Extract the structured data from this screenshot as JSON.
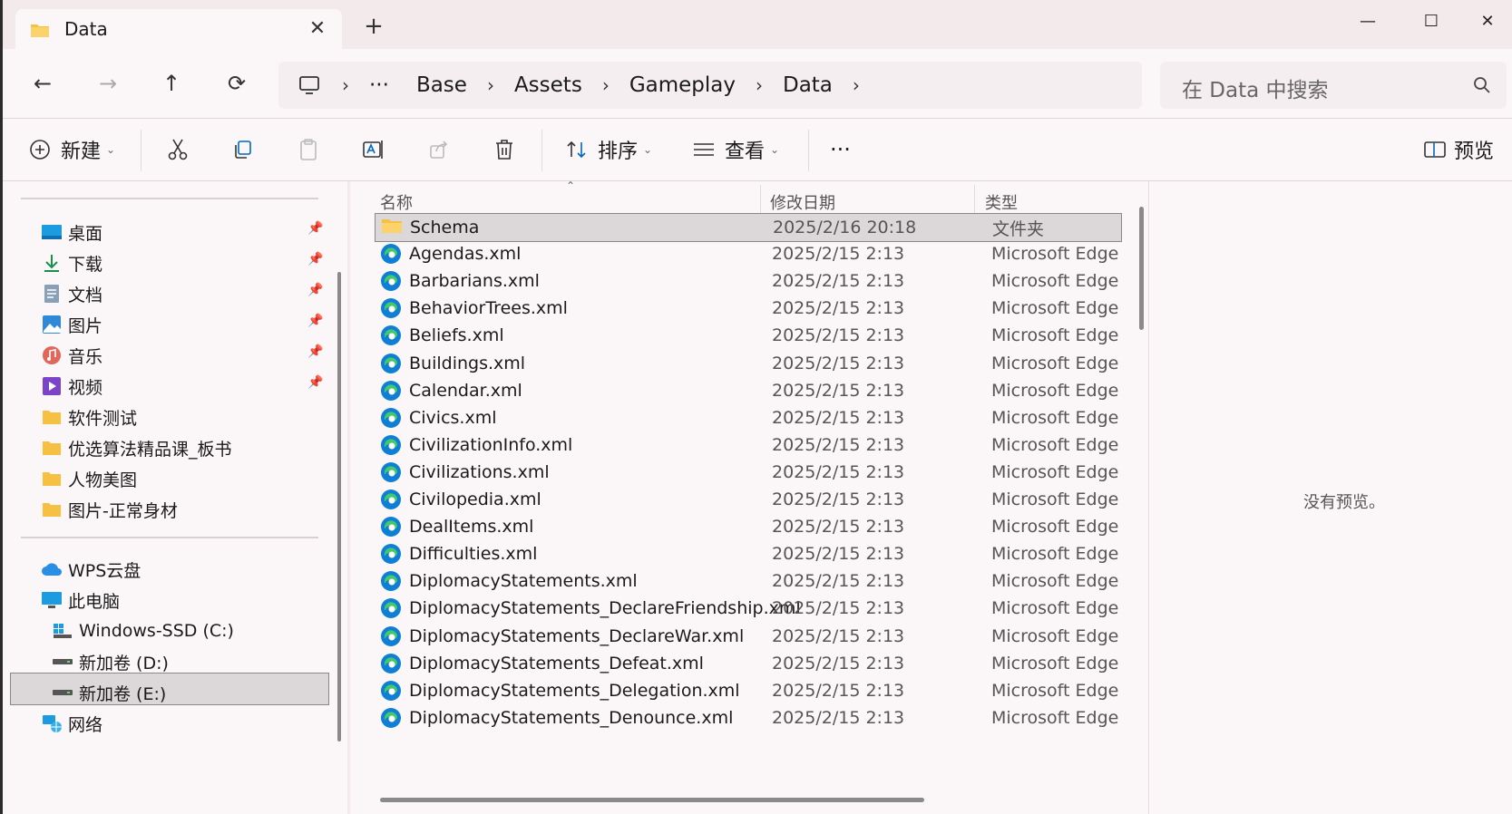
{
  "window": {
    "tab_title": "Data",
    "tab_close": "✕",
    "new_tab": "+",
    "controls": {
      "minimize": "—",
      "maximize": "☐",
      "close": "✕"
    }
  },
  "nav": {
    "back": "←",
    "forward": "→",
    "up": "↑",
    "refresh": "⟳",
    "breadcrumb": [
      "Base",
      "Assets",
      "Gameplay",
      "Data"
    ],
    "overflow": "···",
    "separator": "›",
    "search_placeholder": "在 Data 中搜索"
  },
  "toolbar": {
    "new_label": "新建",
    "sort_label": "排序",
    "view_label": "查看",
    "more_label": "···",
    "preview_label": "预览"
  },
  "sidebar": {
    "quick_access": [
      {
        "label": "桌面",
        "icon": "desktop-icon",
        "pinned": true
      },
      {
        "label": "下载",
        "icon": "download-icon",
        "pinned": true
      },
      {
        "label": "文档",
        "icon": "document-icon",
        "pinned": true
      },
      {
        "label": "图片",
        "icon": "pictures-icon",
        "pinned": true
      },
      {
        "label": "音乐",
        "icon": "music-icon",
        "pinned": true
      },
      {
        "label": "视频",
        "icon": "video-icon",
        "pinned": true
      },
      {
        "label": "软件测试",
        "icon": "folder-icon",
        "pinned": false
      },
      {
        "label": "优选算法精品课_板书",
        "icon": "folder-icon",
        "pinned": false
      },
      {
        "label": "人物美图",
        "icon": "folder-icon",
        "pinned": false
      },
      {
        "label": "图片-正常身材",
        "icon": "folder-icon",
        "pinned": false
      }
    ],
    "locations": [
      {
        "label": "WPS云盘",
        "icon": "cloud-icon"
      },
      {
        "label": "此电脑",
        "icon": "computer-icon"
      },
      {
        "label": "Windows-SSD (C:)",
        "icon": "windows-drive-icon"
      },
      {
        "label": "新加卷 (D:)",
        "icon": "drive-icon",
        "selected": true
      },
      {
        "label": "新加卷 (E:)",
        "icon": "drive-icon"
      },
      {
        "label": "网络",
        "icon": "network-icon"
      }
    ]
  },
  "filelist": {
    "columns": {
      "name": "名称",
      "modified": "修改日期",
      "type": "类型"
    },
    "rows": [
      {
        "name": "Schema",
        "modified": "2025/2/16 20:18",
        "type": "文件夹",
        "icon": "folder-icon",
        "selected": true
      },
      {
        "name": "Agendas.xml",
        "modified": "2025/2/15 2:13",
        "type": "Microsoft Edge",
        "icon": "edge-icon"
      },
      {
        "name": "Barbarians.xml",
        "modified": "2025/2/15 2:13",
        "type": "Microsoft Edge",
        "icon": "edge-icon"
      },
      {
        "name": "BehaviorTrees.xml",
        "modified": "2025/2/15 2:13",
        "type": "Microsoft Edge",
        "icon": "edge-icon"
      },
      {
        "name": "Beliefs.xml",
        "modified": "2025/2/15 2:13",
        "type": "Microsoft Edge",
        "icon": "edge-icon"
      },
      {
        "name": "Buildings.xml",
        "modified": "2025/2/15 2:13",
        "type": "Microsoft Edge",
        "icon": "edge-icon"
      },
      {
        "name": "Calendar.xml",
        "modified": "2025/2/15 2:13",
        "type": "Microsoft Edge",
        "icon": "edge-icon"
      },
      {
        "name": "Civics.xml",
        "modified": "2025/2/15 2:13",
        "type": "Microsoft Edge",
        "icon": "edge-icon"
      },
      {
        "name": "CivilizationInfo.xml",
        "modified": "2025/2/15 2:13",
        "type": "Microsoft Edge",
        "icon": "edge-icon"
      },
      {
        "name": "Civilizations.xml",
        "modified": "2025/2/15 2:13",
        "type": "Microsoft Edge",
        "icon": "edge-icon"
      },
      {
        "name": "Civilopedia.xml",
        "modified": "2025/2/15 2:13",
        "type": "Microsoft Edge",
        "icon": "edge-icon"
      },
      {
        "name": "DealItems.xml",
        "modified": "2025/2/15 2:13",
        "type": "Microsoft Edge",
        "icon": "edge-icon"
      },
      {
        "name": "Difficulties.xml",
        "modified": "2025/2/15 2:13",
        "type": "Microsoft Edge",
        "icon": "edge-icon"
      },
      {
        "name": "DiplomacyStatements.xml",
        "modified": "2025/2/15 2:13",
        "type": "Microsoft Edge",
        "icon": "edge-icon"
      },
      {
        "name": "DiplomacyStatements_DeclareFriendship.xml",
        "modified": "2025/2/15 2:13",
        "type": "Microsoft Edge",
        "icon": "edge-icon"
      },
      {
        "name": "DiplomacyStatements_DeclareWar.xml",
        "modified": "2025/2/15 2:13",
        "type": "Microsoft Edge",
        "icon": "edge-icon"
      },
      {
        "name": "DiplomacyStatements_Defeat.xml",
        "modified": "2025/2/15 2:13",
        "type": "Microsoft Edge",
        "icon": "edge-icon"
      },
      {
        "name": "DiplomacyStatements_Delegation.xml",
        "modified": "2025/2/15 2:13",
        "type": "Microsoft Edge",
        "icon": "edge-icon"
      },
      {
        "name": "DiplomacyStatements_Denounce.xml",
        "modified": "2025/2/15 2:13",
        "type": "Microsoft Edge",
        "icon": "edge-icon"
      }
    ]
  },
  "preview": {
    "empty_text": "没有预览。"
  },
  "colors": {
    "accent": "#0067c0",
    "folder": "#f6c143",
    "selection": "#dcd8da",
    "titlebar": "#f3eaec"
  }
}
